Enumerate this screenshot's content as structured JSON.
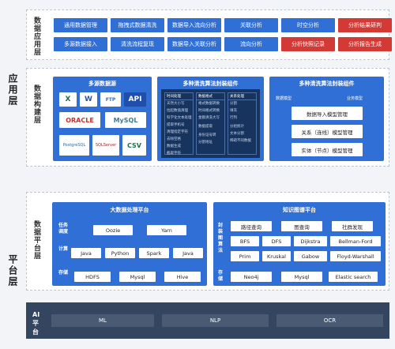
{
  "app_layer": {
    "title": "应用层",
    "data_app": {
      "title": "数据应用层",
      "buttons": [
        {
          "label": "通用数据管理",
          "color": "blue"
        },
        {
          "label": "拖拽式数据清洗",
          "color": "blue"
        },
        {
          "label": "数据导入流向分析",
          "color": "blue"
        },
        {
          "label": "关联分析",
          "color": "blue"
        },
        {
          "label": "时空分析",
          "color": "blue"
        },
        {
          "label": "分析结果研判",
          "color": "red"
        },
        {
          "label": "多源数据接入",
          "color": "blue"
        },
        {
          "label": "清洗流程复现",
          "color": "blue"
        },
        {
          "label": "数据导入关联分析",
          "color": "blue"
        },
        {
          "label": "流向分析",
          "color": "blue"
        },
        {
          "label": "分析快照记录",
          "color": "red"
        },
        {
          "label": "分析报告生成",
          "color": "red"
        }
      ]
    },
    "data_build": {
      "title": "数据构建层",
      "multi_source": {
        "title": "多源数据源",
        "logos": [
          "X",
          "W",
          "FTP",
          "API",
          "ORACLE",
          "MySQL",
          "PostgreSQL",
          "SQLServer",
          "CSV"
        ]
      },
      "clean_components": {
        "title": "多种清洗算法封装组件",
        "columns": [
          {
            "header": "时间处理",
            "rows": [
              "天然大小写",
              "拉起数值清理",
              "科学化文本处理",
              "提取手机号",
              "清理指定字符",
              "去除空格",
              "数据生成",
              "截取字符"
            ]
          },
          {
            "header": "数据格式",
            "rows": [
              "格式数据转换",
              "时间格式转换",
              "金额清洗大写",
              "",
              "数据提取",
              "",
              "身份证号转",
              "分割地址"
            ]
          },
          {
            "header": "关系处理",
            "rows": [
              "分割",
              "填充",
              "行列",
              "",
              "分组统计",
              "文本分割",
              "稀疏不同数据"
            ]
          }
        ]
      },
      "model_components": {
        "title": "多种清洗算法封装组件",
        "col_left": "数据模型",
        "col_right": "业务模型",
        "items": [
          "数据导入模型管理",
          "关系（连线）模型管理",
          "实体（节点）模型管理"
        ]
      }
    }
  },
  "platform_layer": {
    "title": "平台层",
    "data_platform": {
      "title": "数据平台层",
      "bigdata": {
        "title": "大数据处理平台",
        "rows": [
          {
            "label": "任务调度",
            "items": [
              "Oozie",
              "Yarn"
            ]
          },
          {
            "label": "计算",
            "items": [
              "Java",
              "Python",
              "Spark",
              "Java"
            ]
          },
          {
            "label": "存储",
            "items": [
              "HDFS",
              "Mysql",
              "Hive"
            ]
          }
        ]
      },
      "kg": {
        "title": "知识图谱平台",
        "algo_label": "封装图算法",
        "storage_label": "存储",
        "algo_rows": [
          [
            "路径查询",
            "图查询",
            "社群发现"
          ],
          [
            "BFS",
            "DFS",
            "Dijkstra",
            "Bellman-Ford"
          ],
          [
            "Prim",
            "Kruskal",
            "Gabow",
            "Floyd-Warshall"
          ]
        ],
        "storage": [
          "Neo4j",
          "Mysql",
          "Elastic search"
        ]
      }
    },
    "ai": {
      "title": "AI平台",
      "items": [
        "ML",
        "NLP",
        "OCR"
      ]
    }
  },
  "colors": {
    "blue": "#2f6fd6",
    "red": "#d33a36",
    "dark_panel": "#1f3f72",
    "ai_bar": "#344560"
  }
}
